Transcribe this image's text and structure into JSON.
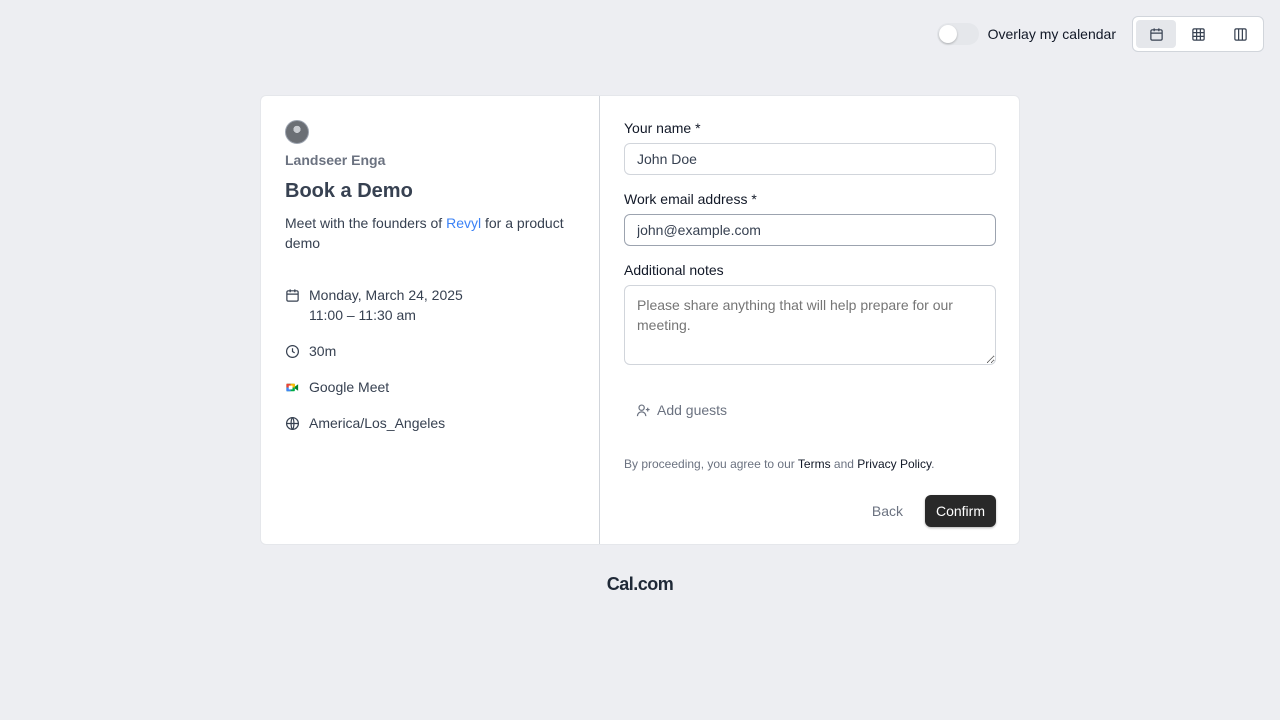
{
  "topbar": {
    "overlay_label": "Overlay my calendar",
    "overlay_on": false,
    "views": [
      {
        "name": "month-view",
        "icon": "calendar-icon",
        "active": true
      },
      {
        "name": "week-view",
        "icon": "grid-icon",
        "active": false
      },
      {
        "name": "column-view",
        "icon": "columns-icon",
        "active": false
      }
    ]
  },
  "event": {
    "organizer": "Landseer Enga",
    "title": "Book a Demo",
    "description_before": "Meet with the founders of ",
    "description_link": "Revyl",
    "description_after": " for a product demo",
    "date": "Monday, March 24, 2025",
    "time": "11:00 – 11:30 am",
    "duration": "30m",
    "location": "Google Meet",
    "timezone": "America/Los_Angeles"
  },
  "form": {
    "name_label": "Your name",
    "name_value": "John Doe",
    "email_label": "Work email address",
    "email_value": "john@example.com",
    "required_mark": "*",
    "notes_label": "Additional notes",
    "notes_placeholder": "Please share anything that will help prepare for our meeting.",
    "add_guests_label": "Add guests",
    "terms_prefix": "By proceeding, you agree to our ",
    "terms_link": "Terms",
    "terms_and": " and ",
    "privacy_link": "Privacy Policy",
    "terms_suffix": ".",
    "back_label": "Back",
    "confirm_label": "Confirm"
  },
  "footer": {
    "brand": "Cal.com"
  },
  "colors": {
    "accent_link": "#3b82f6",
    "confirm_bg": "#292929",
    "page_bg": "#edeef2"
  }
}
